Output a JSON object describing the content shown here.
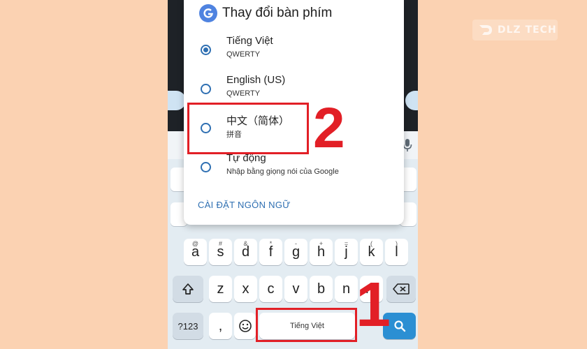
{
  "watermark": {
    "text": "DLZ TECH",
    "icon": "dlz-tech-logo-icon"
  },
  "dialog": {
    "icon": "gboard-icon",
    "title": "Thay đổi bàn phím",
    "options": [
      {
        "label": "Tiếng Việt",
        "sub": "QWERTY",
        "selected": true
      },
      {
        "label": "English (US)",
        "sub": "QWERTY",
        "selected": false
      },
      {
        "label": "中文（简体）",
        "sub": "拼音",
        "selected": false
      },
      {
        "label": "Tự động",
        "sub": "Nhập bằng giọng nói của Google",
        "selected": false
      }
    ],
    "settings_link": "CÀI ĐẶT NGÔN NGỮ"
  },
  "keyboard": {
    "row_asdf": [
      {
        "key": "a",
        "sup": "@"
      },
      {
        "key": "s",
        "sup": "#"
      },
      {
        "key": "d",
        "sup": "&"
      },
      {
        "key": "f",
        "sup": "*"
      },
      {
        "key": "g",
        "sup": "-"
      },
      {
        "key": "h",
        "sup": "+"
      },
      {
        "key": "j",
        "sup": "="
      },
      {
        "key": "k",
        "sup": "("
      },
      {
        "key": "l",
        "sup": ")"
      }
    ],
    "row_zxcv": [
      "z",
      "x",
      "c",
      "v",
      "b",
      "n",
      "m"
    ],
    "sym_key": "?123",
    "comma_key": ",",
    "space_label": "Tiếng Việt",
    "icons": {
      "shift": "shift-icon",
      "backspace": "backspace-icon",
      "emoji": "emoji-icon",
      "search": "search-icon",
      "mic": "mic-icon"
    }
  },
  "annotations": {
    "step1": "1",
    "step2": "2",
    "color": "#e21f26"
  }
}
